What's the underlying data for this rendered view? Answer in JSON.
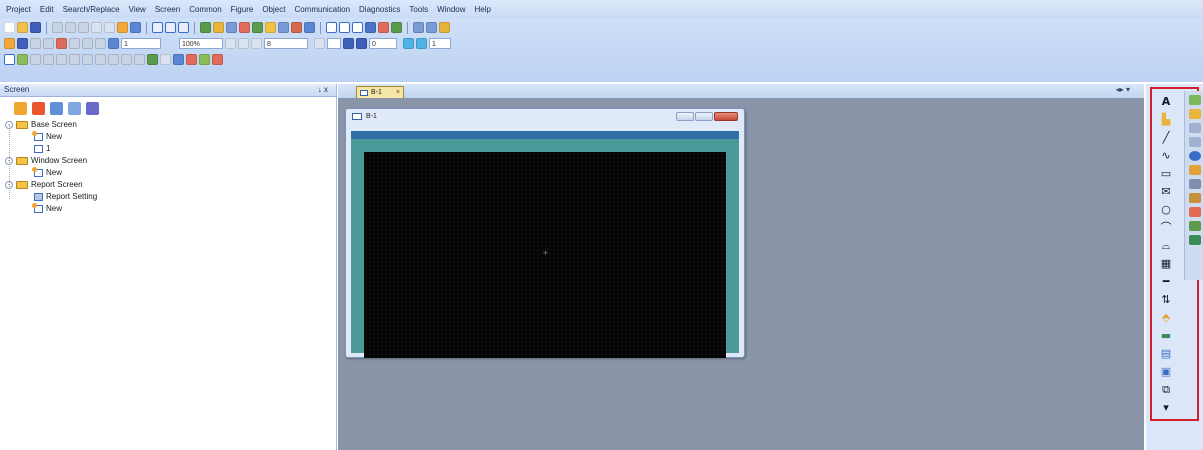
{
  "menu": {
    "items": [
      "Project",
      "Edit",
      "Search/Replace",
      "View",
      "Screen",
      "Common",
      "Figure",
      "Object",
      "Communication",
      "Diagnostics",
      "Tools",
      "Window",
      "Help"
    ]
  },
  "toolbar": {
    "page_number": "1",
    "zoom_level": "100%",
    "grid_value": "8",
    "color_value": "1",
    "rotation_value": "0"
  },
  "screen_panel": {
    "title": "Screen",
    "pin_label": "↓ x",
    "tree": {
      "base_screen": {
        "label": "Base Screen",
        "children": [
          "New",
          "1"
        ]
      },
      "window_screen": {
        "label": "Window Screen",
        "children": [
          "New"
        ]
      },
      "report_screen": {
        "label": "Report Screen",
        "children": [
          "Report Setting",
          "New"
        ]
      }
    }
  },
  "workspace": {
    "tab_label": "B-1",
    "tab_close": "×",
    "nav_arrows": "◂▸ ▾",
    "window_title": "B-1"
  },
  "colors": {
    "canvas": "#050505",
    "workspace_bg": "#8a95a9",
    "highlight_box": "#d21f2b",
    "ribbon_bg": "#c9dbf5"
  },
  "palette": {
    "icons": [
      "text-tool-icon",
      "image-tool-icon",
      "line-tool-icon",
      "polyline-tool-icon",
      "rectangle-tool-icon",
      "envelope-tool-icon",
      "circle-tool-icon",
      "arc-tool-icon",
      "polygon-tool-icon",
      "grid-tool-icon",
      "line-tool-icon-2",
      "slider-tool-icon",
      "shape-tool-icon",
      "picture-tool-icon",
      "table-tool-icon",
      "chart-tool-icon",
      "copy-tool-icon",
      "more-tool-icon"
    ]
  }
}
